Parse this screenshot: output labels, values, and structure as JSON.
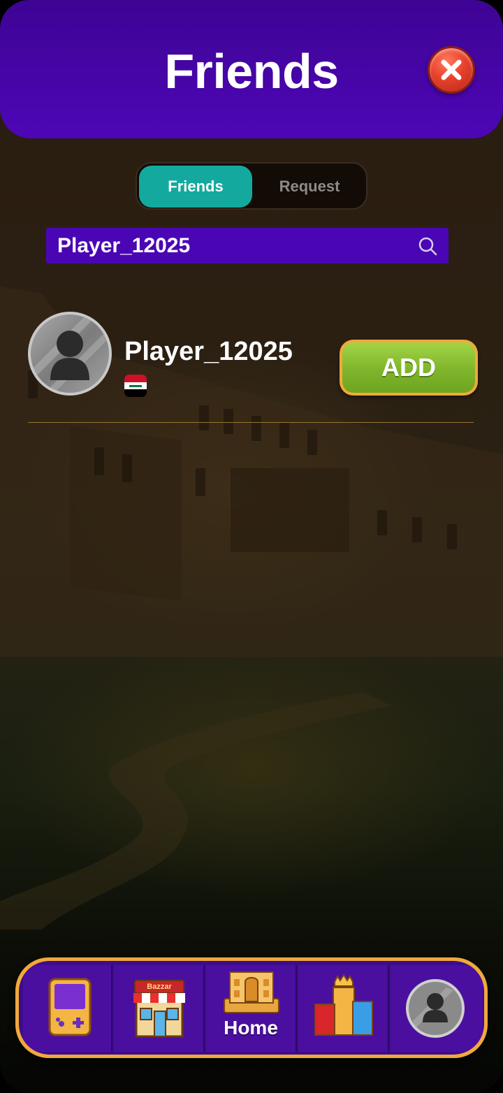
{
  "header": {
    "title": "Friends"
  },
  "tabs": [
    {
      "label": "Friends",
      "active": true
    },
    {
      "label": "Request",
      "active": false
    }
  ],
  "search": {
    "value": "Player_12025",
    "icon": "search-icon"
  },
  "results": [
    {
      "name": "Player_12025",
      "flag": "iraq-flag",
      "action_label": "ADD"
    }
  ],
  "bottom_nav": {
    "items": [
      {
        "name": "games",
        "icon": "gamepad-icon"
      },
      {
        "name": "bazzar",
        "icon": "shop-icon",
        "sign_text": "Bazzar"
      },
      {
        "name": "home",
        "icon": "castle-icon",
        "label": "Home"
      },
      {
        "name": "leaderboard",
        "icon": "podium-icon"
      },
      {
        "name": "profile",
        "icon": "avatar-icon"
      }
    ]
  },
  "colors": {
    "header": "#4d06b6",
    "tab_active": "#13a99f",
    "add_button": "#7fb52c",
    "nav_border": "#f1a93b"
  }
}
